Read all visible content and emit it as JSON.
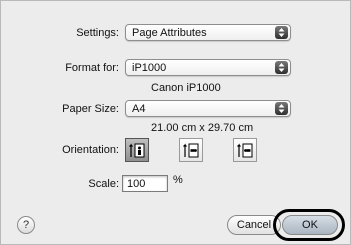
{
  "settings": {
    "label": "Settings:",
    "value": "Page Attributes"
  },
  "format_for": {
    "label": "Format for:",
    "value": "iP1000",
    "printer_name": "Canon iP1000"
  },
  "paper_size": {
    "label": "Paper Size:",
    "value": "A4",
    "dimensions": "21.00 cm x 29.70 cm"
  },
  "orientation": {
    "label": "Orientation:",
    "options": [
      "portrait",
      "landscape",
      "landscape-reversed"
    ],
    "selected": "portrait"
  },
  "scale": {
    "label": "Scale:",
    "value": "100",
    "unit": "%"
  },
  "buttons": {
    "help": "?",
    "cancel": "Cancel",
    "ok": "OK"
  }
}
